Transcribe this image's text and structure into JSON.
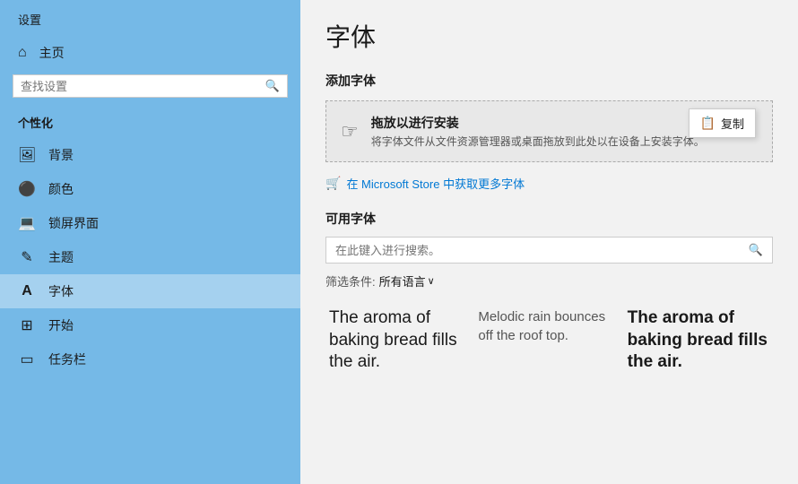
{
  "sidebar": {
    "title": "设置",
    "home": {
      "label": "主页",
      "icon": "⌂"
    },
    "search": {
      "placeholder": "查找设置",
      "icon": "🔍"
    },
    "section_label": "个性化",
    "items": [
      {
        "id": "background",
        "label": "背景",
        "icon": "🖼"
      },
      {
        "id": "color",
        "label": "颜色",
        "icon": "😊"
      },
      {
        "id": "lockscreen",
        "label": "锁屏界面",
        "icon": "🖥"
      },
      {
        "id": "theme",
        "label": "主题",
        "icon": "✎"
      },
      {
        "id": "font",
        "label": "字体",
        "icon": "A",
        "active": true
      },
      {
        "id": "start",
        "label": "开始",
        "icon": "⊞"
      },
      {
        "id": "taskbar",
        "label": "任务栏",
        "icon": "▭"
      }
    ]
  },
  "main": {
    "page_title": "字体",
    "add_font_heading": "添加字体",
    "drop_zone": {
      "title": "拖放以进行安装",
      "subtitle": "将字体文件从文件资源管理器或桌面拖放到此处以在设备上安装字体。",
      "icon": "☝"
    },
    "tooltip": {
      "label": "复制",
      "icon": "📋"
    },
    "store_link": "在 Microsoft Store 中获取更多字体",
    "available_heading": "可用字体",
    "search": {
      "placeholder": "在此键入进行搜索。",
      "icon": "🔍"
    },
    "filter": {
      "label": "筛选条件:",
      "value": "所有语言",
      "chevron": "∨"
    },
    "font_previews": [
      {
        "text": "The aroma of baking bread fills the air.",
        "style": "normal",
        "size": "large"
      },
      {
        "text": "Melodic rain bounces off the roof top.",
        "style": "normal",
        "size": "small"
      },
      {
        "text": "The aroma of baking bread fills the air.",
        "style": "bold",
        "size": "large"
      }
    ]
  }
}
